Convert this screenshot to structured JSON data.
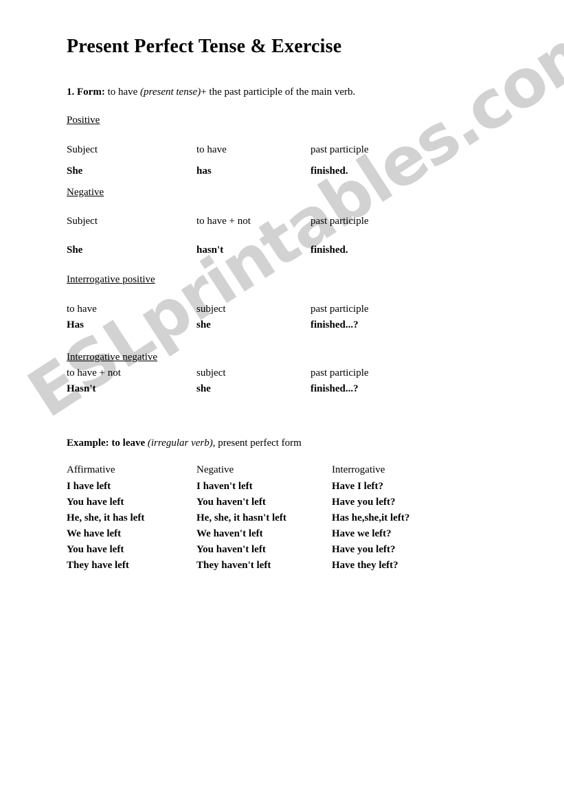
{
  "watermark": {
    "text": "ESLprintables.com",
    "color": "#d2d2d2"
  },
  "title": "Present Perfect Tense & Exercise",
  "form_line": {
    "label": "1. Form:",
    "text_before": " to have ",
    "italic": "(present tense)",
    "text_after": "+ the past participle of the main verb."
  },
  "sections": [
    {
      "heading": "Positive",
      "header_row": {
        "c1": "Subject",
        "c2": "to have",
        "c3": "past participle"
      },
      "example_row": {
        "c1": "She",
        "c2": "has",
        "c3": "finished."
      }
    },
    {
      "heading": "Negative",
      "header_row": {
        "c1": "Subject",
        "c2": "to have + not",
        "c3": "past participle"
      },
      "example_row": {
        "c1": "She",
        "c2": "hasn't",
        "c3": "finished."
      }
    },
    {
      "heading": "Interrogative positive",
      "header_row": {
        "c1": "to have",
        "c2": "subject",
        "c3": "past participle"
      },
      "example_row": {
        "c1": "Has",
        "c2": "she",
        "c3": "finished...?"
      }
    },
    {
      "heading": "Interrogative negative",
      "header_row": {
        "c1": "to have + not",
        "c2": "subject",
        "c3": "past participle"
      },
      "example_row": {
        "c1": "Hasn't",
        "c2": "she",
        "c3": "finished...?"
      }
    }
  ],
  "example_line": {
    "label": "Example: to leave",
    "italic": "(irregular verb)",
    "text_after": ", present perfect form"
  },
  "conjugation": {
    "columns": [
      {
        "header": "Affirmative",
        "items": [
          "I have left",
          "You have left",
          "He, she, it has left",
          "We have left",
          "You have left",
          "They have left"
        ]
      },
      {
        "header": "Negative",
        "items": [
          "I haven't left",
          "You haven't left",
          "He, she, it hasn't left",
          "We haven't left",
          "You haven't left",
          "They haven't left"
        ]
      },
      {
        "header": "Interrogative",
        "items": [
          "Have I left?",
          "Have you left?",
          "Has he,she,it left?",
          "Have we left?",
          "Have you left?",
          "Have they left?"
        ]
      }
    ]
  }
}
